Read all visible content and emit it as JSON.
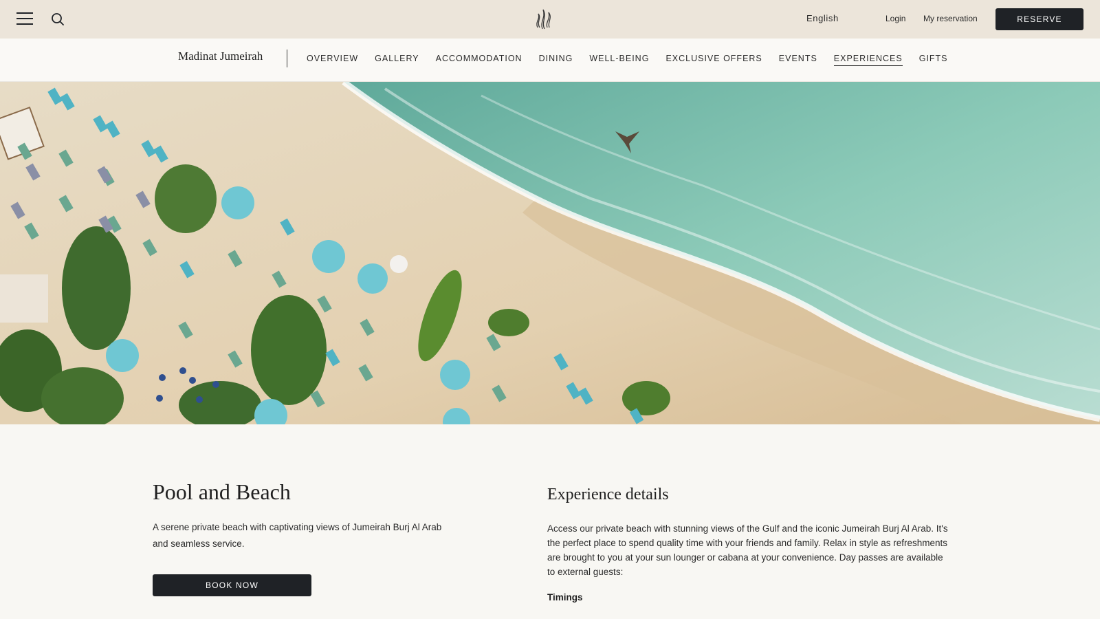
{
  "topbar": {
    "menu_icon": "hamburger-menu-icon",
    "search_icon": "search-icon",
    "logo_icon": "jumeirah-flame-logo-icon",
    "language": "English",
    "login": "Login",
    "my_reservation": "My reservation",
    "reserve": "RESERVE"
  },
  "subnav": {
    "brand": "Madinat Jumeirah",
    "items": [
      {
        "label": "OVERVIEW",
        "active": false
      },
      {
        "label": "GALLERY",
        "active": false
      },
      {
        "label": "ACCOMMODATION",
        "active": false
      },
      {
        "label": "DINING",
        "active": false
      },
      {
        "label": "WELL-BEING",
        "active": false
      },
      {
        "label": "EXCLUSIVE OFFERS",
        "active": false
      },
      {
        "label": "EVENTS",
        "active": false
      },
      {
        "label": "EXPERIENCES",
        "active": true
      },
      {
        "label": "GIFTS",
        "active": false
      }
    ]
  },
  "hero": {
    "image": "aerial-beach-photo"
  },
  "main": {
    "title": "Pool and Beach",
    "intro": "A serene private beach with captivating views of Jumeirah Burj Al Arab and seamless service.",
    "book_now": "BOOK NOW",
    "details_title": "Experience details",
    "details_body": "Access our private beach with stunning views of the Gulf and the iconic Jumeirah Burj Al Arab. It's the perfect place to spend quality time with your friends and family. Relax in style as refreshments are brought to you at your sun lounger or cabana at your convenience. Day passes are available to external guests:",
    "timings_label": "Timings"
  },
  "colors": {
    "topbar_bg": "#ece5da",
    "button_bg": "#1f2226",
    "page_bg": "#f8f7f3",
    "sand": "#e9dcc3",
    "sea": "#9fcfc0",
    "umbrella": "#6fc7d3"
  }
}
